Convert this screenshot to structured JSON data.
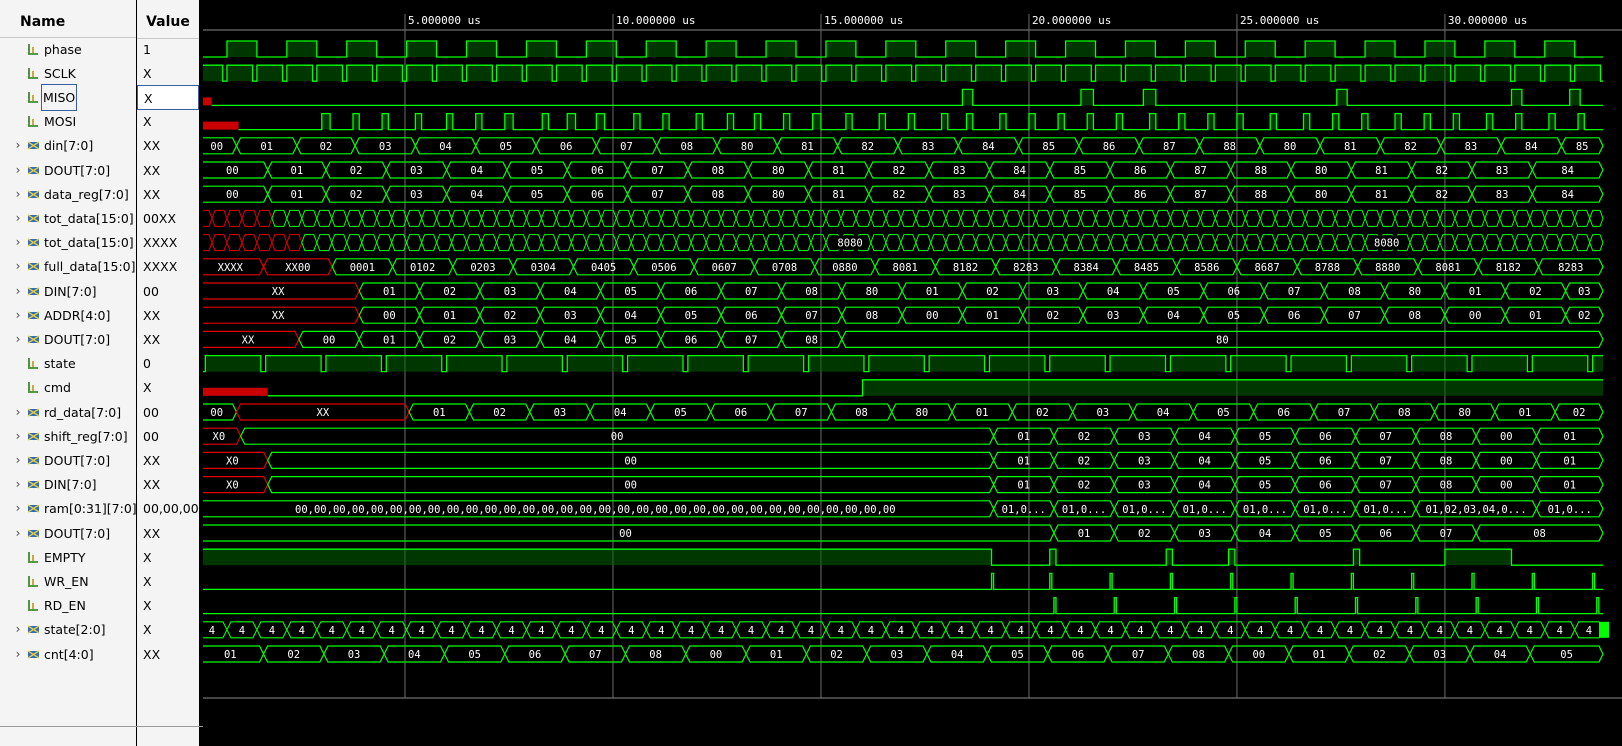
{
  "header": {
    "name_label": "Name",
    "value_label": "Value"
  },
  "colors": {
    "wave": "#00ff00",
    "wave_dim": "#007a00",
    "undefined": "#e00000",
    "background": "#000000",
    "cursor": "#6b6b6b"
  },
  "signals": [
    {
      "name": "phase",
      "value": "1",
      "kind": "bit",
      "icon": "bit-signal-icon"
    },
    {
      "name": "SCLK",
      "value": "X",
      "kind": "bit",
      "icon": "bit-signal-icon"
    },
    {
      "name": "MISO",
      "value": "X",
      "kind": "bit",
      "icon": "bit-signal-icon",
      "selected": true
    },
    {
      "name": "MOSI",
      "value": "X",
      "kind": "bit",
      "icon": "bit-signal-icon"
    },
    {
      "name": "din[7:0]",
      "value": "XX",
      "kind": "bus",
      "icon": "bus-signal-icon"
    },
    {
      "name": "DOUT[7:0]",
      "value": "XX",
      "kind": "bus",
      "icon": "bus-signal-icon"
    },
    {
      "name": "data_reg[7:0]",
      "value": "XX",
      "kind": "bus",
      "icon": "bus-signal-icon"
    },
    {
      "name": "tot_data[15:0]",
      "value": "00XX",
      "kind": "bus",
      "icon": "bus-signal-icon"
    },
    {
      "name": "tot_data[15:0]",
      "value": "XXXX",
      "kind": "bus",
      "icon": "bus-signal-icon"
    },
    {
      "name": "full_data[15:0]",
      "value": "XXXX",
      "kind": "bus",
      "icon": "bus-signal-icon"
    },
    {
      "name": "DIN[7:0]",
      "value": "00",
      "kind": "bus",
      "icon": "bus-signal-icon"
    },
    {
      "name": "ADDR[4:0]",
      "value": "XX",
      "kind": "bus",
      "icon": "bus-signal-icon"
    },
    {
      "name": "DOUT[7:0]",
      "value": "XX",
      "kind": "bus",
      "icon": "bus-signal-icon"
    },
    {
      "name": "state",
      "value": "0",
      "kind": "bit",
      "icon": "bit-signal-icon"
    },
    {
      "name": "cmd",
      "value": "X",
      "kind": "bit",
      "icon": "bit-signal-icon"
    },
    {
      "name": "rd_data[7:0]",
      "value": "00",
      "kind": "bus",
      "icon": "bus-signal-icon"
    },
    {
      "name": "shift_reg[7:0]",
      "value": "00",
      "kind": "bus",
      "icon": "bus-signal-icon"
    },
    {
      "name": "DOUT[7:0]",
      "value": "XX",
      "kind": "bus",
      "icon": "bus-signal-icon"
    },
    {
      "name": "DIN[7:0]",
      "value": "XX",
      "kind": "bus",
      "icon": "bus-signal-icon"
    },
    {
      "name": "ram[0:31][7:0]",
      "value": "00,00,00,",
      "kind": "bus",
      "icon": "bus-signal-icon"
    },
    {
      "name": "DOUT[7:0]",
      "value": "XX",
      "kind": "bus",
      "icon": "bus-signal-icon"
    },
    {
      "name": "EMPTY",
      "value": "X",
      "kind": "bit",
      "icon": "bit-signal-icon"
    },
    {
      "name": "WR_EN",
      "value": "X",
      "kind": "bit",
      "icon": "bit-signal-icon"
    },
    {
      "name": "RD_EN",
      "value": "X",
      "kind": "bit",
      "icon": "bit-signal-icon"
    },
    {
      "name": "state[2:0]",
      "value": "X",
      "kind": "bus",
      "icon": "bus-signal-icon"
    },
    {
      "name": "cnt[4:0]",
      "value": "XX",
      "kind": "bus",
      "icon": "bus-signal-icon"
    }
  ],
  "timeline": {
    "unit": "us",
    "range": [
      0,
      33.8
    ],
    "markers": [
      {
        "t": 5,
        "label": "5.000000 us"
      },
      {
        "t": 10,
        "label": "10.000000 us"
      },
      {
        "t": 15,
        "label": "15.000000 us"
      },
      {
        "t": 20,
        "label": "20.000000 us"
      },
      {
        "t": 25,
        "label": "25.000000 us"
      },
      {
        "t": 30,
        "label": "30.000000 us"
      }
    ]
  },
  "waves": {
    "phase": {
      "t0": 0.0,
      "period": 1.44,
      "duty": 0.5,
      "first": 0
    },
    "SCLK": {
      "t0": 0.0,
      "period": 0.72,
      "duty": 0.86,
      "first": 1
    },
    "MISO": {
      "undef": [
        0,
        0.35
      ],
      "highs": [
        [
          18.4,
          18.65
        ],
        [
          21.25,
          21.55
        ],
        [
          22.75,
          23.05
        ],
        [
          27.4,
          27.65
        ],
        [
          31.6,
          31.85
        ],
        [
          33.0,
          33.25
        ]
      ]
    },
    "MOSI": {
      "undef": [
        0,
        1.0
      ],
      "highs": [
        [
          3.0,
          3.2
        ],
        [
          3.75,
          3.9
        ],
        [
          4.45,
          4.6
        ],
        [
          5.25,
          5.4
        ],
        [
          6.0,
          6.15
        ],
        [
          6.7,
          6.85
        ],
        [
          7.4,
          7.6
        ],
        [
          8.3,
          8.45
        ],
        [
          8.9,
          9.1
        ],
        [
          9.6,
          9.8
        ],
        [
          10.5,
          10.65
        ],
        [
          11.2,
          11.35
        ],
        [
          12.0,
          12.15
        ],
        [
          12.75,
          12.9
        ],
        [
          13.4,
          13.55
        ],
        [
          14.1,
          14.25
        ],
        [
          14.8,
          15.0
        ],
        [
          15.6,
          15.75
        ],
        [
          16.4,
          16.55
        ],
        [
          17.1,
          17.25
        ],
        [
          17.9,
          18.05
        ],
        [
          18.5,
          18.65
        ],
        [
          19.3,
          19.45
        ],
        [
          20.0,
          20.15
        ],
        [
          20.7,
          20.85
        ],
        [
          21.4,
          21.55
        ],
        [
          22.1,
          22.25
        ],
        [
          22.9,
          23.05
        ],
        [
          23.6,
          23.75
        ],
        [
          24.3,
          24.45
        ],
        [
          25.0,
          25.15
        ],
        [
          25.8,
          25.95
        ],
        [
          26.6,
          26.75
        ],
        [
          27.3,
          27.45
        ],
        [
          28.0,
          28.15
        ],
        [
          28.8,
          28.95
        ],
        [
          29.5,
          29.65
        ],
        [
          30.2,
          30.35
        ],
        [
          31.0,
          31.15
        ],
        [
          31.7,
          31.85
        ],
        [
          32.5,
          32.65
        ],
        [
          33.2,
          33.35
        ]
      ]
    },
    "din": {
      "bounds": [
        0,
        0.95,
        2.4,
        3.8,
        5.25,
        6.7,
        8.15,
        9.6,
        11.05,
        12.5,
        13.95,
        15.4,
        16.85,
        18.3,
        19.75,
        21.2,
        22.65,
        24.1,
        25.55,
        27.0,
        28.45,
        29.9,
        31.35,
        32.8,
        33.8
      ],
      "labels": [
        "00",
        "01",
        "02",
        "03",
        "04",
        "05",
        "06",
        "07",
        "08",
        "80",
        "81",
        "82",
        "83",
        "84",
        "85",
        "86",
        "87",
        "88",
        "80",
        "81",
        "82",
        "83",
        "84",
        "85"
      ]
    },
    "DOUT_a": {
      "bounds": [
        0,
        1.7,
        3.1,
        4.55,
        6.0,
        7.45,
        8.9,
        10.35,
        11.8,
        13.25,
        14.7,
        16.15,
        17.6,
        19.05,
        20.5,
        21.95,
        23.4,
        24.85,
        26.3,
        27.75,
        29.2,
        30.65,
        32.1,
        33.8
      ],
      "labels": [
        "00",
        "01",
        "02",
        "03",
        "04",
        "05",
        "06",
        "07",
        "08",
        "80",
        "81",
        "82",
        "83",
        "84",
        "85",
        "86",
        "87",
        "88",
        "80",
        "81",
        "82",
        "83",
        "84"
      ]
    },
    "data_reg": {
      "bounds": [
        0,
        1.7,
        3.1,
        4.55,
        6.0,
        7.45,
        8.9,
        10.35,
        11.8,
        13.25,
        14.7,
        16.15,
        17.6,
        19.05,
        20.5,
        21.95,
        23.4,
        24.85,
        26.3,
        27.75,
        29.2,
        30.65,
        32.1,
        33.8
      ],
      "labels": [
        "00",
        "01",
        "02",
        "03",
        "04",
        "05",
        "06",
        "07",
        "08",
        "80",
        "81",
        "82",
        "83",
        "84",
        "85",
        "86",
        "87",
        "88",
        "80",
        "81",
        "82",
        "83",
        "84"
      ]
    },
    "tot_a": {
      "firstUndef": 1.6
    },
    "tot_b": {
      "firstUndef": 2.4,
      "labels": [
        [
          15.7,
          "8080"
        ],
        [
          28.6,
          "8080"
        ]
      ]
    },
    "full_data": {
      "bounds": [
        0,
        1.6,
        3.25,
        4.7,
        6.15,
        7.6,
        9.05,
        10.5,
        11.95,
        13.4,
        14.85,
        16.3,
        17.75,
        19.2,
        20.65,
        22.1,
        23.55,
        25.0,
        26.45,
        27.9,
        29.35,
        30.8,
        32.25,
        33.8
      ],
      "labels": [
        "XXXX",
        "XX00",
        "0001",
        "0102",
        "0203",
        "0304",
        "0405",
        "0506",
        "0607",
        "0708",
        "0880",
        "8081",
        "8182",
        "8283",
        "8384",
        "8485",
        "8586",
        "8687",
        "8788",
        "8880",
        "8081",
        "8182",
        "8283"
      ],
      "undefCount": 2
    },
    "DIN_a": {
      "bounds": [
        0,
        3.9,
        5.35,
        6.8,
        8.25,
        9.7,
        11.15,
        12.6,
        14.05,
        15.5,
        16.95,
        18.4,
        19.85,
        21.3,
        22.75,
        24.2,
        25.65,
        27.1,
        28.55,
        30.0,
        31.45,
        32.9,
        33.8
      ],
      "labels": [
        "XX",
        "01",
        "02",
        "03",
        "04",
        "05",
        "06",
        "07",
        "08",
        "80",
        "01",
        "02",
        "03",
        "04",
        "05",
        "06",
        "07",
        "08",
        "80",
        "01",
        "02",
        "03"
      ],
      "undefCount": 1
    },
    "ADDR": {
      "bounds": [
        0,
        3.9,
        5.35,
        6.8,
        8.25,
        9.7,
        11.15,
        12.6,
        14.05,
        15.5,
        16.95,
        18.4,
        19.85,
        21.3,
        22.75,
        24.2,
        25.65,
        27.1,
        28.55,
        30.0,
        31.45,
        32.9,
        33.8
      ],
      "labels": [
        "XX",
        "00",
        "01",
        "02",
        "03",
        "04",
        "05",
        "06",
        "07",
        "08",
        "00",
        "01",
        "02",
        "03",
        "04",
        "05",
        "06",
        "07",
        "08",
        "00",
        "01",
        "02"
      ],
      "undefCount": 1
    },
    "DOUT_b": {
      "bounds": [
        0,
        2.45,
        3.9,
        5.35,
        6.8,
        8.25,
        9.7,
        11.15,
        12.6,
        14.05,
        15.5,
        33.8
      ],
      "labels": [
        "XX",
        "00",
        "01",
        "02",
        "03",
        "04",
        "05",
        "06",
        "07",
        "08",
        "80"
      ],
      "undefCount": 1
    },
    "state": {
      "t0": 0.2,
      "period": 1.45,
      "duty": 0.92,
      "first": 1
    },
    "cmd": {
      "undef": [
        0,
        1.7
      ],
      "riseAt": 16.0
    },
    "rd_data": {
      "bounds": [
        0,
        0.95,
        5.1,
        6.55,
        8.0,
        9.45,
        10.9,
        12.35,
        13.8,
        15.25,
        16.7,
        18.15,
        19.6,
        21.05,
        22.5,
        23.95,
        25.4,
        26.85,
        28.3,
        29.75,
        31.2,
        32.65,
        33.8
      ],
      "labels": [
        "00",
        "XX",
        "01",
        "02",
        "03",
        "04",
        "05",
        "06",
        "07",
        "08",
        "80",
        "01",
        "02",
        "03",
        "04",
        "05",
        "06",
        "07",
        "08",
        "80",
        "01",
        "02"
      ],
      "undefIdx": [
        1
      ]
    },
    "shift_reg": {
      "bounds": [
        0,
        1.05,
        19.15,
        20.6,
        22.05,
        23.5,
        24.95,
        26.4,
        27.85,
        29.3,
        30.75,
        32.2,
        33.8
      ],
      "labels": [
        "X0",
        "00",
        "01",
        "02",
        "03",
        "04",
        "05",
        "06",
        "07",
        "08",
        "00",
        "01"
      ],
      "undefCount": 1
    },
    "DOUT_c": {
      "bounds": [
        0,
        1.7,
        19.15,
        20.6,
        22.05,
        23.5,
        24.95,
        26.4,
        27.85,
        29.3,
        30.75,
        32.2,
        33.8
      ],
      "labels": [
        "X0",
        "00",
        "01",
        "02",
        "03",
        "04",
        "05",
        "06",
        "07",
        "08",
        "00",
        "01"
      ],
      "undefCount": 1
    },
    "DIN_b": {
      "bounds": [
        0,
        1.7,
        19.15,
        20.6,
        22.05,
        23.5,
        24.95,
        26.4,
        27.85,
        29.3,
        30.75,
        32.2,
        33.8
      ],
      "labels": [
        "X0",
        "00",
        "01",
        "02",
        "03",
        "04",
        "05",
        "06",
        "07",
        "08",
        "00",
        "01"
      ],
      "undefCount": 1
    },
    "ram": {
      "bounds": [
        0,
        19.15,
        20.6,
        22.05,
        23.5,
        24.95,
        26.4,
        27.85,
        29.3,
        32.2,
        33.8
      ],
      "labels": [
        "00,00,00,00,00,00,00,00,00,00,00,00,00,00,00,00,00,00,00,00,00,00,00,00,00,00,00,00,00,00,00,00",
        "01,0...",
        "01,0...",
        "01,0...",
        "01,0...",
        "01,0...",
        "01,0...",
        "01,0...",
        "01,02,03,04,0...",
        "01,0..."
      ]
    },
    "DOUT_d": {
      "bounds": [
        0,
        20.6,
        22.05,
        23.5,
        24.95,
        26.4,
        27.85,
        29.3,
        30.75,
        33.8
      ],
      "labels": [
        "00",
        "01",
        "02",
        "03",
        "04",
        "05",
        "06",
        "07",
        "08"
      ]
    },
    "EMPTY": {
      "segments": [
        [
          0,
          19.1,
          1
        ],
        [
          19.1,
          20.5,
          0
        ],
        [
          20.5,
          20.65,
          1
        ],
        [
          20.65,
          23.3,
          0
        ],
        [
          23.3,
          23.45,
          1
        ],
        [
          23.45,
          24.8,
          0
        ],
        [
          24.8,
          24.95,
          1
        ],
        [
          24.95,
          27.8,
          0
        ],
        [
          27.8,
          27.95,
          1
        ],
        [
          27.95,
          30.0,
          0
        ],
        [
          30.0,
          31.6,
          1
        ],
        [
          31.6,
          33.8,
          0
        ]
      ]
    },
    "WR_EN": {
      "pulses": [
        19.1,
        20.5,
        21.95,
        23.4,
        24.85,
        26.3,
        27.75,
        29.2,
        30.65,
        32.1,
        33.55
      ]
    },
    "RD_EN": {
      "pulses": [
        20.6,
        22.05,
        23.5,
        24.95,
        26.4,
        27.85,
        29.3,
        30.75,
        32.2,
        33.65
      ]
    },
    "state3": {
      "period": 0.72,
      "label": "4"
    },
    "cnt": {
      "bounds": [
        0,
        1.6,
        3.05,
        4.5,
        5.95,
        7.4,
        8.85,
        10.3,
        11.75,
        13.2,
        14.65,
        16.1,
        17.55,
        19.0,
        20.45,
        21.9,
        23.35,
        24.8,
        26.25,
        27.7,
        29.15,
        30.6,
        32.05,
        33.8
      ],
      "labels": [
        "01",
        "02",
        "03",
        "04",
        "05",
        "06",
        "07",
        "08",
        "00",
        "01",
        "02",
        "03",
        "04",
        "05",
        "06",
        "07",
        "08",
        "00",
        "01",
        "02",
        "03",
        "04",
        "05"
      ]
    }
  }
}
